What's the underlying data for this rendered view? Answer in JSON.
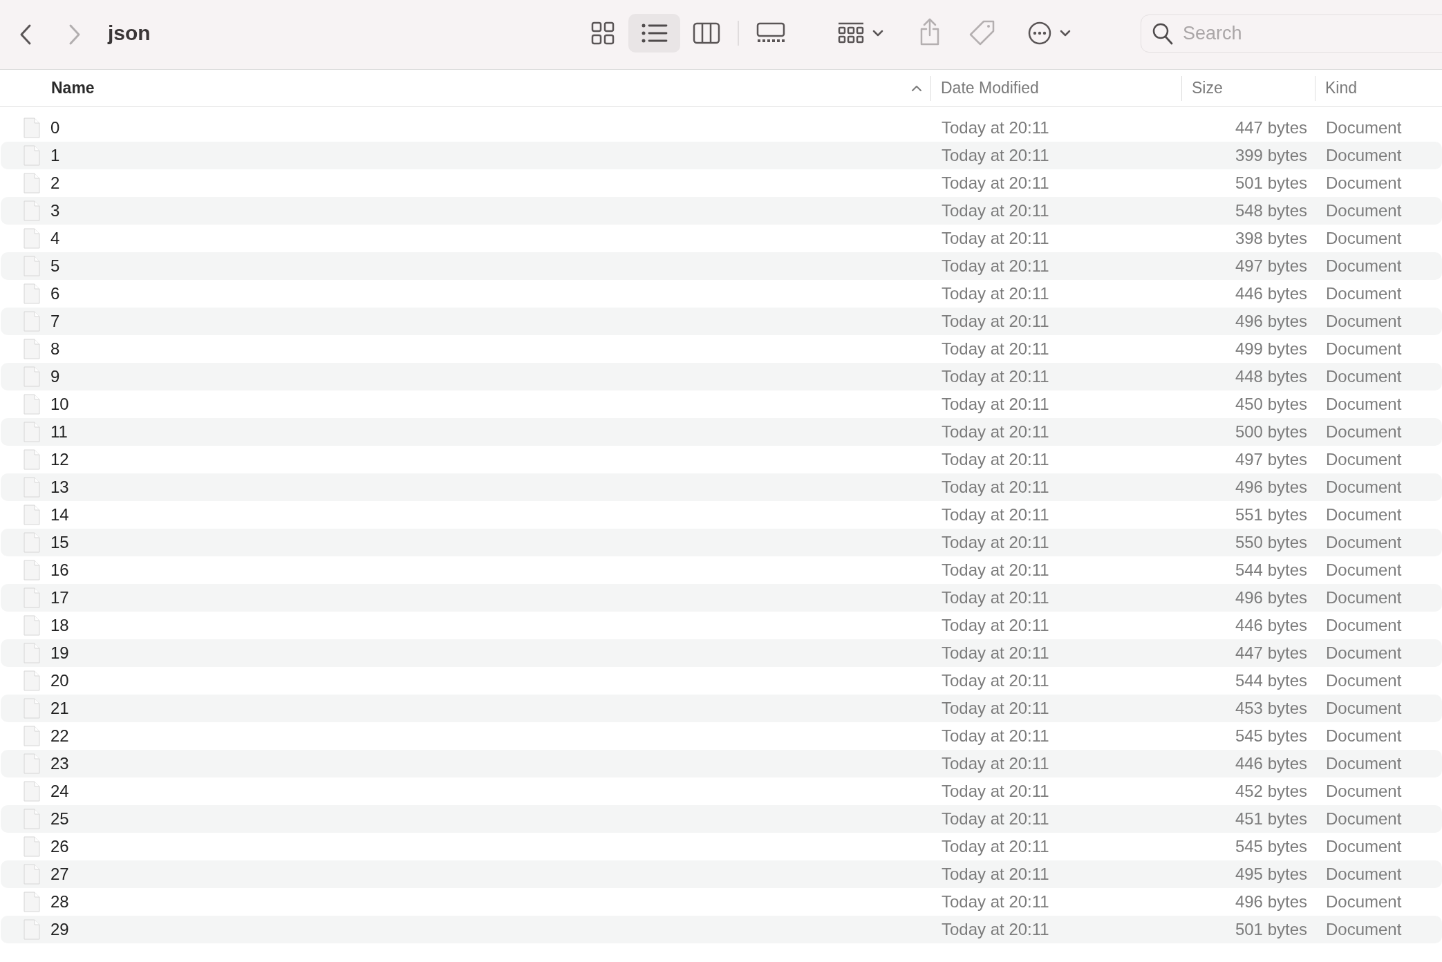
{
  "toolbar": {
    "title": "json",
    "view_buttons": [
      {
        "kind": "icons",
        "selected": false
      },
      {
        "kind": "list",
        "selected": true
      },
      {
        "kind": "columns",
        "selected": false
      },
      {
        "kind": "gallery",
        "selected": false
      }
    ],
    "search": {
      "placeholder": "Search"
    }
  },
  "table": {
    "columns": [
      {
        "label": "Name",
        "sorted": true
      },
      {
        "label": "Date Modified",
        "sorted": false
      },
      {
        "label": "Size",
        "sorted": false
      },
      {
        "label": "Kind",
        "sorted": false
      }
    ],
    "rows": [
      {
        "name": "0",
        "date": "Today at 20:11",
        "size": "447 bytes",
        "kind": "Document"
      },
      {
        "name": "1",
        "date": "Today at 20:11",
        "size": "399 bytes",
        "kind": "Document"
      },
      {
        "name": "2",
        "date": "Today at 20:11",
        "size": "501 bytes",
        "kind": "Document"
      },
      {
        "name": "3",
        "date": "Today at 20:11",
        "size": "548 bytes",
        "kind": "Document"
      },
      {
        "name": "4",
        "date": "Today at 20:11",
        "size": "398 bytes",
        "kind": "Document"
      },
      {
        "name": "5",
        "date": "Today at 20:11",
        "size": "497 bytes",
        "kind": "Document"
      },
      {
        "name": "6",
        "date": "Today at 20:11",
        "size": "446 bytes",
        "kind": "Document"
      },
      {
        "name": "7",
        "date": "Today at 20:11",
        "size": "496 bytes",
        "kind": "Document"
      },
      {
        "name": "8",
        "date": "Today at 20:11",
        "size": "499 bytes",
        "kind": "Document"
      },
      {
        "name": "9",
        "date": "Today at 20:11",
        "size": "448 bytes",
        "kind": "Document"
      },
      {
        "name": "10",
        "date": "Today at 20:11",
        "size": "450 bytes",
        "kind": "Document"
      },
      {
        "name": "11",
        "date": "Today at 20:11",
        "size": "500 bytes",
        "kind": "Document"
      },
      {
        "name": "12",
        "date": "Today at 20:11",
        "size": "497 bytes",
        "kind": "Document"
      },
      {
        "name": "13",
        "date": "Today at 20:11",
        "size": "496 bytes",
        "kind": "Document"
      },
      {
        "name": "14",
        "date": "Today at 20:11",
        "size": "551 bytes",
        "kind": "Document"
      },
      {
        "name": "15",
        "date": "Today at 20:11",
        "size": "550 bytes",
        "kind": "Document"
      },
      {
        "name": "16",
        "date": "Today at 20:11",
        "size": "544 bytes",
        "kind": "Document"
      },
      {
        "name": "17",
        "date": "Today at 20:11",
        "size": "496 bytes",
        "kind": "Document"
      },
      {
        "name": "18",
        "date": "Today at 20:11",
        "size": "446 bytes",
        "kind": "Document"
      },
      {
        "name": "19",
        "date": "Today at 20:11",
        "size": "447 bytes",
        "kind": "Document"
      },
      {
        "name": "20",
        "date": "Today at 20:11",
        "size": "544 bytes",
        "kind": "Document"
      },
      {
        "name": "21",
        "date": "Today at 20:11",
        "size": "453 bytes",
        "kind": "Document"
      },
      {
        "name": "22",
        "date": "Today at 20:11",
        "size": "545 bytes",
        "kind": "Document"
      },
      {
        "name": "23",
        "date": "Today at 20:11",
        "size": "446 bytes",
        "kind": "Document"
      },
      {
        "name": "24",
        "date": "Today at 20:11",
        "size": "452 bytes",
        "kind": "Document"
      },
      {
        "name": "25",
        "date": "Today at 20:11",
        "size": "451 bytes",
        "kind": "Document"
      },
      {
        "name": "26",
        "date": "Today at 20:11",
        "size": "545 bytes",
        "kind": "Document"
      },
      {
        "name": "27",
        "date": "Today at 20:11",
        "size": "495 bytes",
        "kind": "Document"
      },
      {
        "name": "28",
        "date": "Today at 20:11",
        "size": "496 bytes",
        "kind": "Document"
      },
      {
        "name": "29",
        "date": "Today at 20:11",
        "size": "501 bytes",
        "kind": "Document"
      }
    ]
  }
}
